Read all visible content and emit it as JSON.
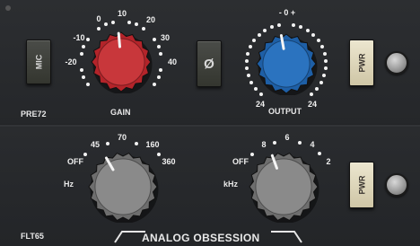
{
  "top": {
    "mic_label": "MIC",
    "phase_label": "Ø",
    "pwr_label": "PWR",
    "module_name": "PRE72",
    "gain": {
      "label": "GAIN",
      "scale": [
        "-20",
        "-10",
        "0",
        "10",
        "20",
        "30",
        "40"
      ],
      "color": "#b3242a"
    },
    "output": {
      "label": "OUTPUT",
      "scale_top": "- 0 +",
      "left_min": "24",
      "right_max": "24",
      "color": "#1e5fa6"
    }
  },
  "bottom": {
    "module_name": "FLT65",
    "pwr_label": "PWR",
    "hz": {
      "unit": "Hz",
      "scale": [
        "OFF",
        "45",
        "70",
        "160",
        "360"
      ],
      "color": "#7b7b7b"
    },
    "khz": {
      "unit": "kHz",
      "scale": [
        "OFF",
        "8",
        "6",
        "4",
        "2"
      ],
      "color": "#7b7b7b"
    }
  },
  "brand": "ANALOG OBSESSION"
}
